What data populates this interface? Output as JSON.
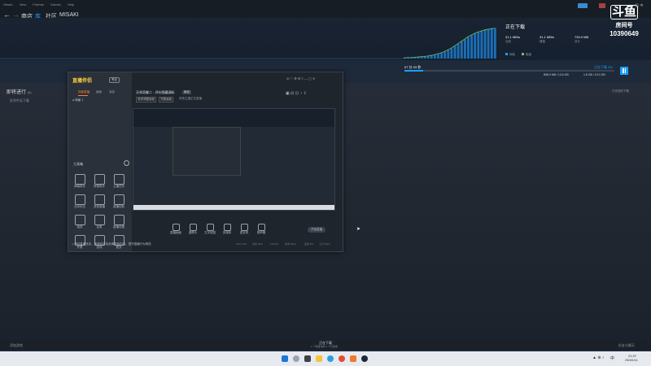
{
  "menubar": {
    "items": [
      "Steam",
      "View",
      "Friends",
      "Games",
      "Help"
    ]
  },
  "navbar": {
    "tabs": [
      "商店",
      "库",
      "社区",
      "MISAKI"
    ]
  },
  "download": {
    "title": "正在下载",
    "stats": [
      {
        "value": "31.1 MB/s",
        "label": "当前"
      },
      {
        "value": "31.1 MB/s",
        "label": "峰值"
      },
      {
        "value": "730.0 MB",
        "label": "总计"
      }
    ],
    "legend": [
      "网络",
      "磁盘"
    ],
    "game_title": "天命奇御二 Fate Seeker II",
    "time_left": "07 分 03 秒",
    "percent": "正在下载 9%",
    "progress": 0.09,
    "downloaded": "898.9 MB / 13.6 GB",
    "disk": "1.8 GB / 19.0 GB"
  },
  "douyu": {
    "logo": "斗鱼",
    "room_label": "房间号",
    "room_id": "10390649"
  },
  "queue": {
    "heading": "即将进行",
    "count": "(0)",
    "sub": "队列中无下载",
    "right_label": "已完成的下载"
  },
  "overlay": {
    "logo_text": "直播伴侣",
    "badge": "专业",
    "left_tabs": [
      "场景直播",
      "画面",
      "添加"
    ],
    "scene_name": "场景 1",
    "tools_heading": "工具箱",
    "tools": [
      "弹幕助手",
      "房管助手",
      "主播任务",
      "互动玩法",
      "语音直播",
      "直播回放",
      "抽奖",
      "连麦",
      "直播设置",
      "开黑",
      "游戏",
      "更多"
    ],
    "window_title": "天命奇御二 - 评价隐藏调料",
    "window_badge": "新品",
    "top_tags": [
      "音质调整面板",
      "完整画面",
      "其他主播正在直播"
    ],
    "controls": [
      "直播画面",
      "摄像头",
      "文字贴图",
      "多媒体",
      "麦克风",
      "扬声器"
    ],
    "start_label": "开始直播",
    "notice": "请勿直播违法、违规内容及色情低俗内容，遵守直播行为规范",
    "status": [
      "CPU 12%",
      "内存 45%",
      "FPS 60",
      "码率 0kb/s",
      "丢帧 0%",
      "上行 0kb/s"
    ]
  },
  "footer": {
    "left": "添加游戏",
    "center_title": "正在下载",
    "center_sub": "1 个项目中的 1 个已完成",
    "right": "好友与聊天"
  },
  "taskbar": {
    "time": "21:37",
    "date": "2024/1/14",
    "lang": "中"
  },
  "graph_bars": [
    0.02,
    0.03,
    0.03,
    0.04,
    0.05,
    0.06,
    0.07,
    0.08,
    0.1,
    0.12,
    0.15,
    0.18,
    0.22,
    0.27,
    0.33,
    0.4,
    0.47,
    0.55,
    0.62,
    0.7,
    0.76,
    0.82,
    0.87,
    0.9,
    0.94,
    0.96,
    0.98,
    1.0
  ]
}
